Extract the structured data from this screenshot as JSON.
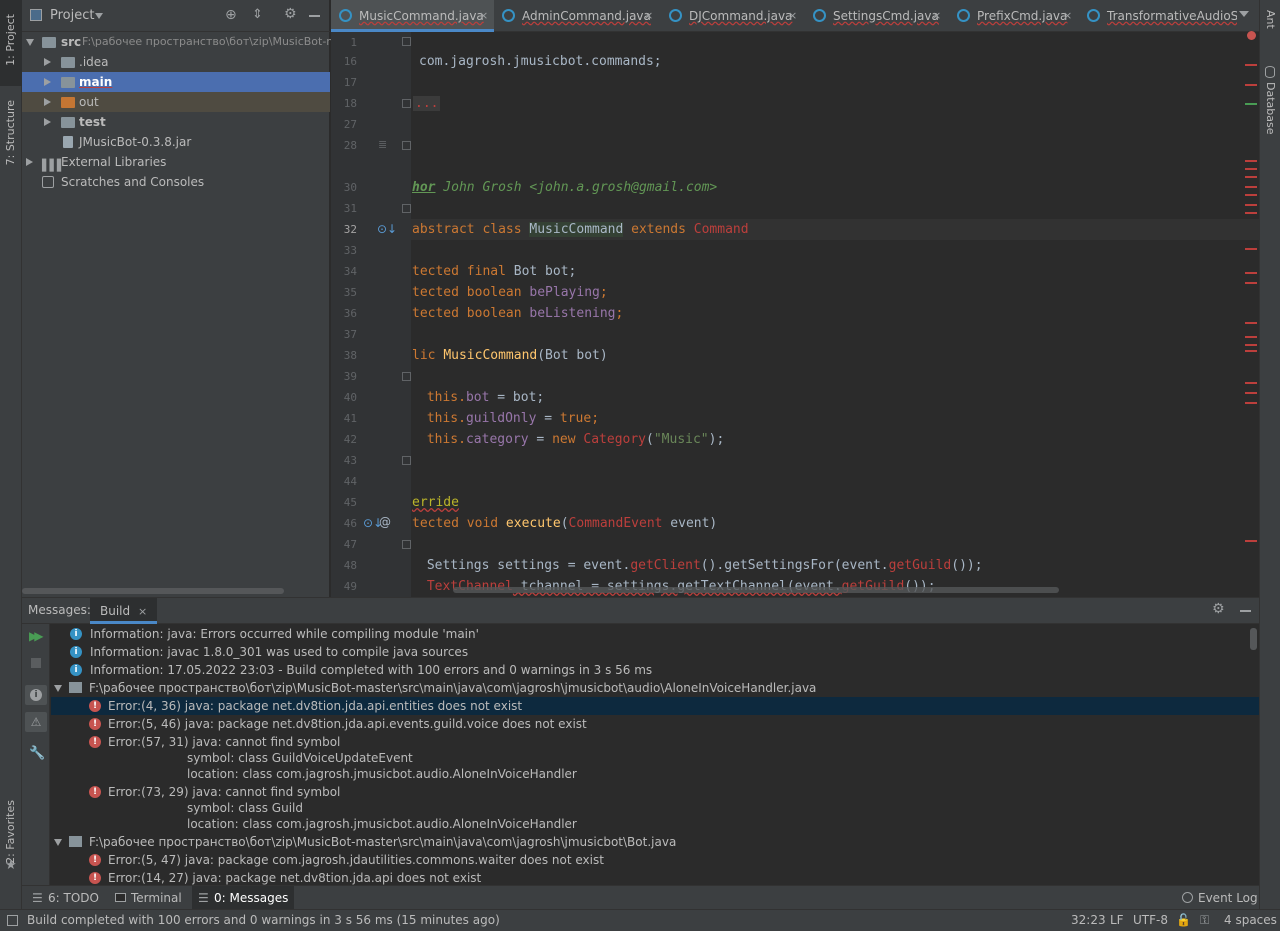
{
  "left_tabs": {
    "project": "1: Project",
    "structure": "7: Structure",
    "favorites": "2: Favorites"
  },
  "right_tabs": {
    "ant": "Ant",
    "database": "Database"
  },
  "project_panel": {
    "title": "Project",
    "tree": [
      {
        "label": "src",
        "path": "F:\\рабочее пространство\\бот\\zip\\MusicBot-m"
      },
      {
        "label": ".idea"
      },
      {
        "label": "main"
      },
      {
        "label": "out"
      },
      {
        "label": "test"
      },
      {
        "label": "JMusicBot-0.3.8.jar"
      },
      {
        "label": "External Libraries"
      },
      {
        "label": "Scratches and Consoles"
      }
    ]
  },
  "editor_tabs": [
    "MusicCommand.java",
    "AdminCommand.java",
    "DJCommand.java",
    "SettingsCmd.java",
    "PrefixCmd.java",
    "TransformativeAudioSou"
  ],
  "line_numbers": [
    "1",
    "16",
    "17",
    "18",
    "27",
    "28",
    "30",
    "31",
    "32",
    "33",
    "34",
    "35",
    "36",
    "37",
    "38",
    "39",
    "40",
    "41",
    "42",
    "43",
    "44",
    "45",
    "46",
    "47",
    "48",
    "49"
  ],
  "code": {
    "l16": "com.jagrosh.jmusicbot.commands;",
    "l18": "...",
    "l30a": "hor",
    "l30b": " John Grosh <john.a.grosh@gmail.com>",
    "l32a": "abstract class ",
    "l32b": "MusicCommand",
    "l32c": " extends ",
    "l32d": "Command",
    "l34a": "tected final ",
    "l34b": "Bot bot;",
    "l35a": "tected boolean ",
    "l35b": "bePlaying",
    "l36a": "tected boolean ",
    "l36b": "beListening",
    "l38a": "lic ",
    "l38b": "MusicCommand",
    "l38c": "(Bot bot)",
    "l40a": " this.",
    "l40b": "bot",
    "l40c": " = bot;",
    "l41a": " this.",
    "l41b": "guildOnly",
    "l41c": " = ",
    "l41d": "true",
    "l42a": " this.",
    "l42b": "category",
    "l42c": " = ",
    "l42d": "new ",
    "l42e": "Category",
    "l42f": "(",
    "l42g": "\"Music\"",
    "l42h": ");",
    "l45": "erride",
    "l46a": "tected void ",
    "l46b": "execute",
    "l46c": "(",
    "l46d": "CommandEvent",
    "l46e": " event)",
    "l48a": " Settings settings = event.",
    "l48b": "getClient",
    "l48c": "().getSettingsFor(event.",
    "l48d": "getGuild",
    "l48e": "());",
    "l49a": " TextChannel",
    "l49b": " tchannel = settings.getTextChannel(event.",
    "l49c": "getGuild",
    "l49d": "());"
  },
  "messages": {
    "label": "Messages:",
    "tab": "Build",
    "rows": [
      "Information: java: Errors occurred while compiling module 'main'",
      "Information: javac 1.8.0_301 was used to compile java sources",
      "Information: 17.05.2022 23:03 - Build completed with 100 errors and 0 warnings in 3 s 56 ms",
      "F:\\рабочее пространство\\бот\\zip\\MusicBot-master\\src\\main\\java\\com\\jagrosh\\jmusicbot\\audio\\AloneInVoiceHandler.java",
      "Error:(4, 36)  java: package net.dv8tion.jda.api.entities does not exist",
      "Error:(5, 46)  java: package net.dv8tion.jda.api.events.guild.voice does not exist",
      "Error:(57, 31)  java: cannot find symbol",
      "symbol:   class GuildVoiceUpdateEvent",
      "location: class com.jagrosh.jmusicbot.audio.AloneInVoiceHandler",
      "Error:(73, 29)  java: cannot find symbol",
      "symbol:   class Guild",
      "location: class com.jagrosh.jmusicbot.audio.AloneInVoiceHandler",
      "F:\\рабочее пространство\\бот\\zip\\MusicBot-master\\src\\main\\java\\com\\jagrosh\\jmusicbot\\Bot.java",
      "Error:(5, 47)  java: package com.jagrosh.jdautilities.commons.waiter does not exist",
      "Error:(14, 27)  java: package net.dv8tion.jda.api does not exist"
    ]
  },
  "bottom_tabs": {
    "todo": "6: TODO",
    "terminal": "Terminal",
    "messages": "0: Messages",
    "event_log": "Event Log"
  },
  "status": {
    "text": "Build completed with 100 errors and 0 warnings in 3 s 56 ms (15 minutes ago)",
    "position": "32:23",
    "line_sep": "LF",
    "encoding": "UTF-8",
    "indent": "4 spaces"
  }
}
